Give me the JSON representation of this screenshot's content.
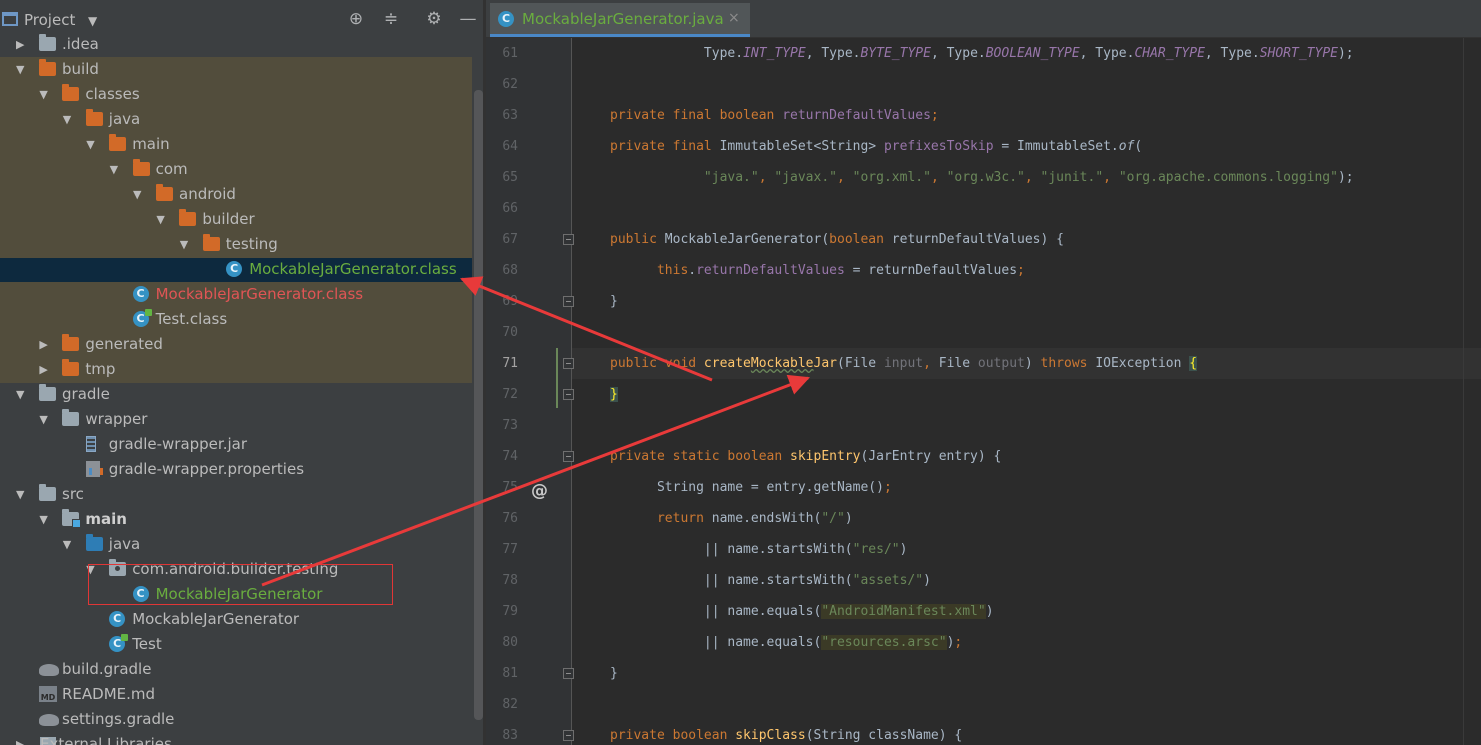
{
  "project_panel": {
    "title": "Project",
    "toolbar_icons": [
      "locate-icon",
      "collapse-all-icon",
      "settings-gear-icon",
      "hide-minimize-icon"
    ],
    "tree": [
      {
        "label": ".idea",
        "arrow": "▶",
        "icon": "folder-gray",
        "indent": 0
      },
      {
        "label": "build",
        "arrow": "▼",
        "icon": "folder-orange",
        "indent": 0
      },
      {
        "label": "classes",
        "arrow": "▼",
        "icon": "folder-orange",
        "indent": 1
      },
      {
        "label": "java",
        "arrow": "▼",
        "icon": "folder-orange",
        "indent": 2
      },
      {
        "label": "main",
        "arrow": "▼",
        "icon": "folder-orange",
        "indent": 3
      },
      {
        "label": "com",
        "arrow": "▼",
        "icon": "folder-orange",
        "indent": 4
      },
      {
        "label": "android",
        "arrow": "▼",
        "icon": "folder-orange",
        "indent": 5
      },
      {
        "label": "builder",
        "arrow": "▼",
        "icon": "folder-orange",
        "indent": 6
      },
      {
        "label": "testing",
        "arrow": "▼",
        "icon": "folder-orange",
        "indent": 7
      },
      {
        "label": "MockableJarGenerator.class",
        "arrow": "",
        "icon": "class",
        "indent": 8,
        "color": "green",
        "selected": true
      },
      {
        "label": "MockableJarGenerator.class",
        "arrow": "",
        "icon": "class",
        "indent": 4,
        "color": "red"
      },
      {
        "label": "Test.class",
        "arrow": "",
        "icon": "class-test",
        "indent": 4
      },
      {
        "label": "generated",
        "arrow": "▶",
        "icon": "folder-orange",
        "indent": 1
      },
      {
        "label": "tmp",
        "arrow": "▶",
        "icon": "folder-orange",
        "indent": 1
      },
      {
        "label": "gradle",
        "arrow": "▼",
        "icon": "folder-gray",
        "indent": 0
      },
      {
        "label": "wrapper",
        "arrow": "▼",
        "icon": "folder-gray",
        "indent": 1
      },
      {
        "label": "gradle-wrapper.jar",
        "arrow": "",
        "icon": "jar",
        "indent": 2
      },
      {
        "label": "gradle-wrapper.properties",
        "arrow": "",
        "icon": "properties",
        "indent": 2
      },
      {
        "label": "src",
        "arrow": "▼",
        "icon": "folder-gray",
        "indent": 0
      },
      {
        "label": "main",
        "arrow": "▼",
        "icon": "folder-main",
        "indent": 1,
        "bold": true
      },
      {
        "label": "java",
        "arrow": "▼",
        "icon": "folder-blue",
        "indent": 2
      },
      {
        "label": "com.android.builder.testing",
        "arrow": "▼",
        "icon": "package",
        "indent": 3
      },
      {
        "label": "MockableJarGenerator",
        "arrow": "",
        "icon": "class",
        "indent": 4,
        "color": "green"
      },
      {
        "label": "MockableJarGenerator",
        "arrow": "",
        "icon": "class",
        "indent": 3
      },
      {
        "label": "Test",
        "arrow": "",
        "icon": "class-test",
        "indent": 3
      },
      {
        "label": "build.gradle",
        "arrow": "",
        "icon": "gradle",
        "indent": 0
      },
      {
        "label": "README.md",
        "arrow": "",
        "icon": "md",
        "indent": 0
      },
      {
        "label": "settings.gradle",
        "arrow": "",
        "icon": "gradle",
        "indent": 0
      },
      {
        "label": "External Libraries",
        "arrow": "▶",
        "icon": "library",
        "indent": -1
      }
    ]
  },
  "editor": {
    "tab": {
      "label": "MockableJarGenerator.java",
      "close": "×"
    },
    "current_line": 71,
    "lines": [
      {
        "n": 61,
        "segs": [
          [
            "",
            "            Type."
          ],
          [
            "sfld",
            "INT_TYPE"
          ],
          [
            "",
            ", Type."
          ],
          [
            "sfld",
            "BYTE_TYPE"
          ],
          [
            "",
            ", Type."
          ],
          [
            "sfld",
            "BOOLEAN_TYPE"
          ],
          [
            "",
            ", Type."
          ],
          [
            "sfld",
            "CHAR_TYPE"
          ],
          [
            "",
            ", Type."
          ],
          [
            "sfld",
            "SHORT_TYPE"
          ],
          [
            "",
            ");"
          ]
        ]
      },
      {
        "n": 62,
        "segs": []
      },
      {
        "n": 63,
        "segs": [
          [
            "kw",
            "private final boolean "
          ],
          [
            "fld",
            "returnDefaultValues"
          ],
          [
            "kw",
            ";"
          ]
        ]
      },
      {
        "n": 64,
        "segs": [
          [
            "kw",
            "private final "
          ],
          [
            "",
            "ImmutableSet<String> "
          ],
          [
            "fld",
            "prefixesToSkip"
          ],
          [
            "",
            " = ImmutableSet."
          ],
          [
            "smth",
            "of"
          ],
          [
            "",
            "("
          ]
        ]
      },
      {
        "n": 65,
        "segs": [
          [
            "",
            "            "
          ],
          [
            "str",
            "\"java.\""
          ],
          [
            "kw",
            ", "
          ],
          [
            "str",
            "\"javax.\""
          ],
          [
            "kw",
            ", "
          ],
          [
            "str",
            "\"org.xml.\""
          ],
          [
            "kw",
            ", "
          ],
          [
            "str",
            "\"org.w3c.\""
          ],
          [
            "kw",
            ", "
          ],
          [
            "str",
            "\"junit.\""
          ],
          [
            "kw",
            ", "
          ],
          [
            "str",
            "\"org.apache.commons.logging\""
          ],
          [
            "",
            ");"
          ]
        ]
      },
      {
        "n": 66,
        "segs": []
      },
      {
        "n": 67,
        "segs": [
          [
            "kw",
            "public "
          ],
          [
            "",
            "MockableJarGenerator("
          ],
          [
            "kw",
            "boolean "
          ],
          [
            "",
            "returnDefaultValues) {"
          ]
        ]
      },
      {
        "n": 68,
        "segs": [
          [
            "",
            "      "
          ],
          [
            "kw",
            "this"
          ],
          [
            "",
            "."
          ],
          [
            "fld",
            "returnDefaultValues"
          ],
          [
            "",
            " = returnDefaultValues"
          ],
          [
            "kw",
            ";"
          ]
        ]
      },
      {
        "n": 69,
        "segs": [
          [
            "",
            "}"
          ]
        ]
      },
      {
        "n": 70,
        "segs": []
      },
      {
        "n": 71,
        "segs": [
          [
            "kw",
            "public void "
          ],
          [
            "mth",
            "create"
          ],
          [
            "mth squig",
            "Mockable"
          ],
          [
            "mth",
            "Jar"
          ],
          [
            "",
            "(File "
          ],
          [
            "gray",
            "input"
          ],
          [
            "kw",
            ", "
          ],
          [
            "",
            "File "
          ],
          [
            "gray",
            "output"
          ],
          [
            "",
            ") "
          ],
          [
            "kw",
            "throws "
          ],
          [
            "",
            "IOException "
          ],
          [
            "brace-hl",
            "{"
          ]
        ]
      },
      {
        "n": 72,
        "segs": [
          [
            "brace-hl",
            "}"
          ]
        ]
      },
      {
        "n": 73,
        "segs": []
      },
      {
        "n": 74,
        "segs": [
          [
            "kw",
            "private static boolean "
          ],
          [
            "mth",
            "skipEntry"
          ],
          [
            "",
            "(JarEntry entry) {"
          ]
        ]
      },
      {
        "n": 75,
        "segs": [
          [
            "",
            "      String name = entry.getName()"
          ],
          [
            "kw",
            ";"
          ]
        ]
      },
      {
        "n": 76,
        "segs": [
          [
            "",
            "      "
          ],
          [
            "kw",
            "return "
          ],
          [
            "",
            "name.endsWith("
          ],
          [
            "str",
            "\"/\""
          ],
          [
            "",
            ")"
          ]
        ]
      },
      {
        "n": 77,
        "segs": [
          [
            "",
            "            || name.startsWith("
          ],
          [
            "str",
            "\"res/\""
          ],
          [
            "",
            ")"
          ]
        ]
      },
      {
        "n": 78,
        "segs": [
          [
            "",
            "            || name.startsWith("
          ],
          [
            "str",
            "\"assets/\""
          ],
          [
            "",
            ")"
          ]
        ]
      },
      {
        "n": 79,
        "segs": [
          [
            "",
            "            || name.equals("
          ],
          [
            "str str-hl",
            "\"AndroidManifest.xml\""
          ],
          [
            "",
            ")"
          ]
        ]
      },
      {
        "n": 80,
        "segs": [
          [
            "",
            "            || name.equals("
          ],
          [
            "str str-hl",
            "\"resources.arsc\""
          ],
          [
            "",
            ")"
          ],
          [
            "kw",
            ";"
          ]
        ]
      },
      {
        "n": 81,
        "segs": [
          [
            "",
            "}"
          ]
        ]
      },
      {
        "n": 82,
        "segs": []
      },
      {
        "n": 83,
        "segs": [
          [
            "kw",
            "private boolean "
          ],
          [
            "mth",
            "skipClass"
          ],
          [
            "",
            "(String className) {"
          ]
        ]
      }
    ]
  },
  "colors": {
    "arrow": "#e83a3a",
    "highlight_box": "#e03636",
    "accent_tab": "#4a88c7"
  }
}
